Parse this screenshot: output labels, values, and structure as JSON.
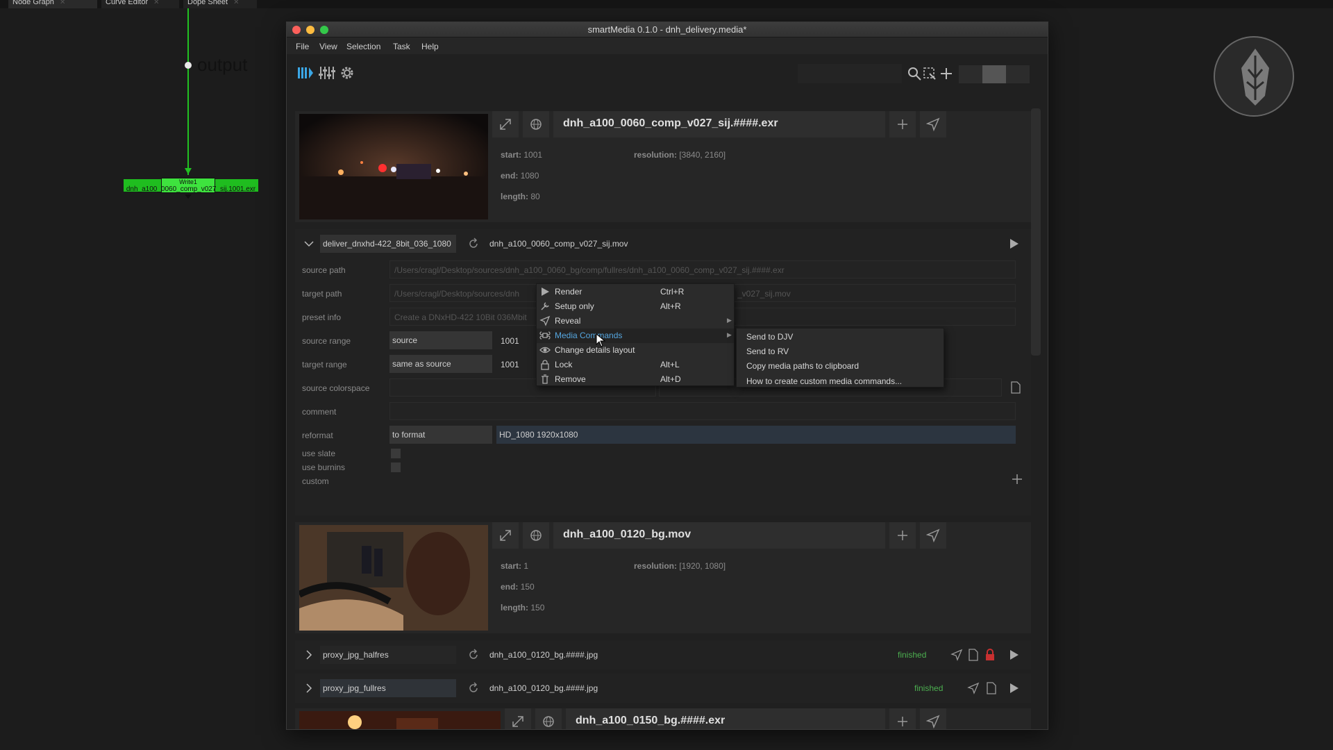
{
  "background": {
    "tabs": [
      "Node Graph",
      "Curve Editor",
      "Dope Sheet"
    ],
    "node_graph": {
      "output_label": "output",
      "node_title": "Write1",
      "node_label": "dnh_a100_0060_comp_v027_sij.1001.exr"
    }
  },
  "window": {
    "title": "smartMedia 0.1.0 - dnh_delivery.media*",
    "menu": [
      "File",
      "View",
      "Selection",
      "Task",
      "Help"
    ]
  },
  "media": [
    {
      "name": "dnh_a100_0060_comp_v027_sij.####.exr",
      "start_label": "start:",
      "start": "1001",
      "end_label": "end:",
      "end": "1080",
      "length_label": "length:",
      "length": "80",
      "resolution_label": "resolution:",
      "resolution": "[3840, 2160]"
    },
    {
      "name": "dnh_a100_0120_bg.mov",
      "start_label": "start:",
      "start": "1",
      "end_label": "end:",
      "end": "150",
      "length_label": "length:",
      "length": "150",
      "resolution_label": "resolution:",
      "resolution": "[1920, 1080]"
    },
    {
      "name": "dnh_a100_0150_bg.####.exr"
    }
  ],
  "task1": {
    "preset": "deliver_dnxhd-422_8bit_036_1080",
    "output": "dnh_a100_0060_comp_v027_sij.mov",
    "labels": {
      "source_path": "source path",
      "target_path": "target path",
      "preset_info": "preset info",
      "source_range": "source range",
      "target_range": "target range",
      "source_colorspace": "source colorspace",
      "comment": "comment",
      "reformat": "reformat",
      "use_slate": "use slate",
      "use_burnins": "use burnins",
      "custom": "custom"
    },
    "source_path": "/Users/cragl/Desktop/sources/dnh_a100_0060_bg/comp/fullres/dnh_a100_0060_comp_v027_sij.####.exr",
    "target_path_left": "/Users/cragl/Desktop/sources/dnh",
    "target_path_right": "_v027_sij.mov",
    "preset_info": "Create a DNxHD-422 10Bit 036Mbit",
    "source_range": "source",
    "source_range_start": "1001",
    "target_range": "same as source",
    "target_range_start": "1001",
    "reformat": "to format",
    "reformat_value": "HD_1080 1920x1080"
  },
  "task2": [
    {
      "preset": "proxy_jpg_halfres",
      "output": "dnh_a100_0120_bg.####.jpg",
      "status": "finished"
    },
    {
      "preset": "proxy_jpg_fullres",
      "output": "dnh_a100_0120_bg.####.jpg",
      "status": "finished"
    }
  ],
  "context_menu": {
    "items": [
      {
        "label": "Render",
        "shortcut": "Ctrl+R"
      },
      {
        "label": "Setup only",
        "shortcut": "Alt+R"
      },
      {
        "label": "Reveal",
        "shortcut": ""
      },
      {
        "label": "Media Commands",
        "shortcut": ""
      },
      {
        "label": "Change details layout",
        "shortcut": ""
      },
      {
        "label": "Lock",
        "shortcut": "Alt+L"
      },
      {
        "label": "Remove",
        "shortcut": "Alt+D"
      }
    ],
    "submenu": [
      "Send to DJV",
      "Send to RV",
      "Copy media paths to clipboard",
      "How to create custom media commands..."
    ]
  },
  "colors": {
    "accent": "#56a7e0",
    "finished": "#4caf50",
    "node_green": "#22c122"
  }
}
